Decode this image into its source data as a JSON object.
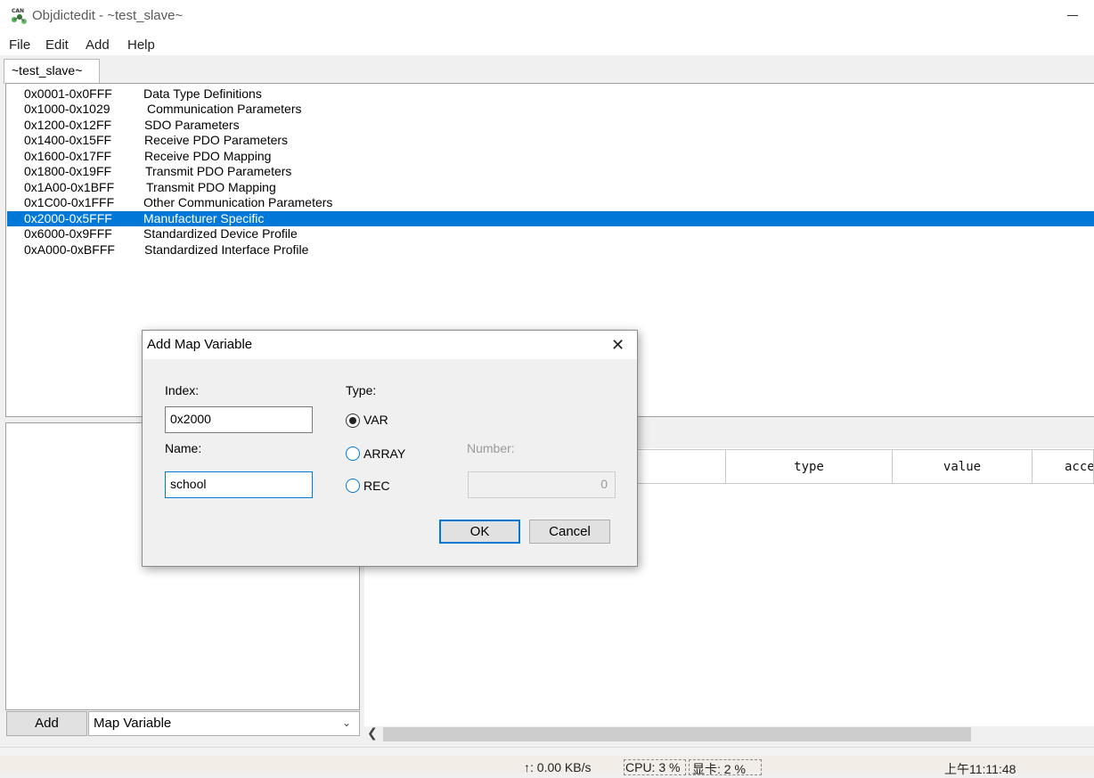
{
  "window": {
    "title": "Objdictedit - ~test_slave~",
    "icon_text": "CAN"
  },
  "menu": {
    "items": [
      "File",
      "Edit",
      "Add",
      "Help"
    ]
  },
  "tabs": [
    {
      "label": "~test_slave~"
    }
  ],
  "index_list": {
    "rows": [
      {
        "range": "0x0001-0x0FFF",
        "name": "Data Type Definitions"
      },
      {
        "range": "0x1000-0x1029",
        "name": "Communication Parameters"
      },
      {
        "range": "0x1200-0x12FF",
        "name": "SDO Parameters"
      },
      {
        "range": "0x1400-0x15FF",
        "name": "Receive PDO Parameters"
      },
      {
        "range": "0x1600-0x17FF",
        "name": "Receive PDO Mapping"
      },
      {
        "range": "0x1800-0x19FF",
        "name": "Transmit PDO Parameters"
      },
      {
        "range": "0x1A00-0x1BFF",
        "name": "Transmit PDO Mapping"
      },
      {
        "range": "0x1C00-0x1FFF",
        "name": "Other Communication Parameters"
      },
      {
        "range": "0x2000-0x5FFF",
        "name": "Manufacturer Specific"
      },
      {
        "range": "0x6000-0x9FFF",
        "name": "Standardized Device Profile"
      },
      {
        "range": "0xA000-0xBFFF",
        "name": "Standardized Interface Profile"
      }
    ],
    "selected_index": 8,
    "selection_color": "#0078d7"
  },
  "bottom_controls": {
    "add_label": "Add",
    "type_selected": "Map Variable"
  },
  "grid": {
    "headers": [
      "type",
      "value",
      "acce"
    ]
  },
  "dialog": {
    "title": "Add Map Variable",
    "index_label": "Index:",
    "index_value": "0x2000",
    "name_label": "Name:",
    "name_value": "school",
    "type_label": "Type:",
    "type_options": [
      "VAR",
      "ARRAY",
      "REC"
    ],
    "type_selected": "VAR",
    "number_label": "Number:",
    "number_value": "0",
    "ok_label": "OK",
    "cancel_label": "Cancel"
  },
  "tray": {
    "net_speed": "↑: 0.00 KB/s",
    "cpu": "CPU: 3 %",
    "gpu": "显卡: 2 %",
    "clock": "上午11:11:48"
  }
}
